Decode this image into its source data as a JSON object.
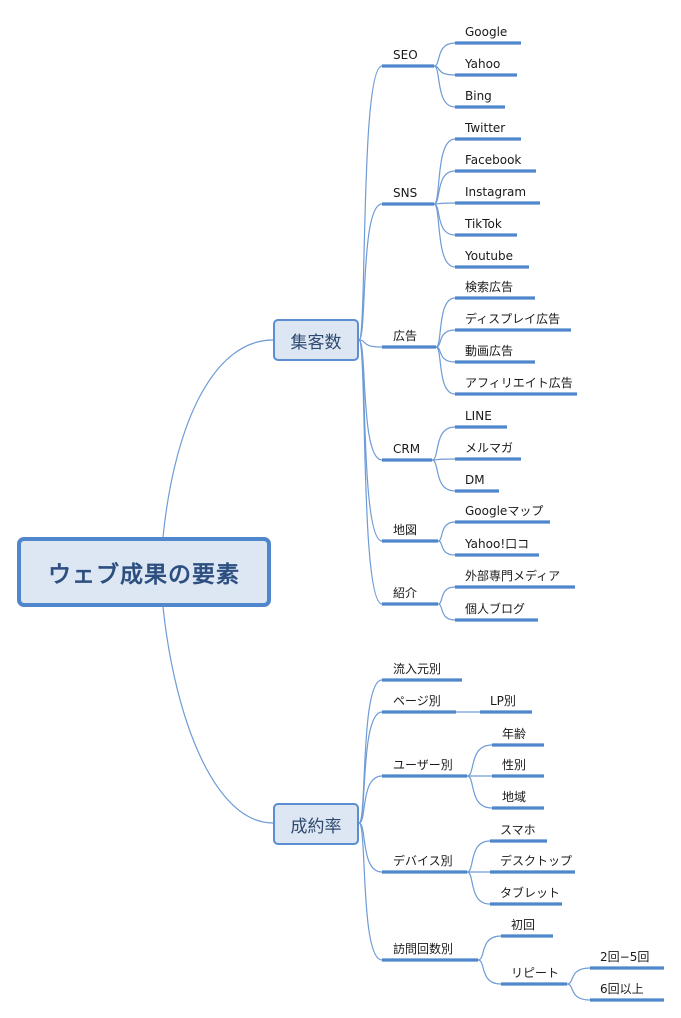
{
  "title": "ウェブ成果の要素",
  "branches": [
    {
      "label": "集客数",
      "children": [
        {
          "label": "SEO",
          "children": [
            {
              "label": "Google"
            },
            {
              "label": "Yahoo"
            },
            {
              "label": "Bing"
            }
          ]
        },
        {
          "label": "SNS",
          "children": [
            {
              "label": "Twitter"
            },
            {
              "label": "Facebook"
            },
            {
              "label": "Instagram"
            },
            {
              "label": "TikTok"
            },
            {
              "label": "Youtube"
            }
          ]
        },
        {
          "label": "広告",
          "children": [
            {
              "label": "検索広告"
            },
            {
              "label": "ディスプレイ広告"
            },
            {
              "label": "動画広告"
            },
            {
              "label": "アフィリエイト広告"
            }
          ]
        },
        {
          "label": "CRM",
          "children": [
            {
              "label": "LINE"
            },
            {
              "label": "メルマガ"
            },
            {
              "label": "DM"
            }
          ]
        },
        {
          "label": "地図",
          "children": [
            {
              "label": "Googleマップ"
            },
            {
              "label": "Yahoo!口コ"
            }
          ]
        },
        {
          "label": "紹介",
          "children": [
            {
              "label": "外部専門メディア"
            },
            {
              "label": "個人ブログ"
            }
          ]
        }
      ]
    },
    {
      "label": "成約率",
      "children": [
        {
          "label": "流入元別",
          "children": []
        },
        {
          "label": "ページ別",
          "children": [
            {
              "label": "LP別"
            }
          ]
        },
        {
          "label": "ユーザー別",
          "children": [
            {
              "label": "年齢"
            },
            {
              "label": "性別"
            },
            {
              "label": "地域"
            }
          ]
        },
        {
          "label": "デバイス別",
          "children": [
            {
              "label": "スマホ"
            },
            {
              "label": "デスクトップ"
            },
            {
              "label": "タブレット"
            }
          ]
        },
        {
          "label": "訪問回数別",
          "children": [
            {
              "label": "初回"
            },
            {
              "label": "リピート",
              "children": [
                {
                  "label": "2回−5回"
                },
                {
                  "label": "6回以上"
                }
              ]
            }
          ]
        }
      ]
    }
  ],
  "colors": {
    "line": "#4f86cc",
    "thin": "#6f9bd6",
    "box_fill": "#dde7f4",
    "root_text": "#2d4f80"
  }
}
